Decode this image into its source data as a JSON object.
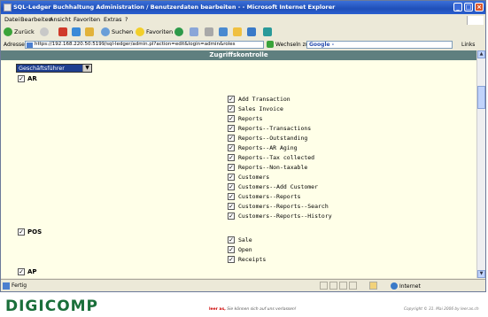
{
  "window": {
    "title": "SQL-Ledger Buchhaltung Administration / Benutzerdaten bearbeiten - - Microsoft Internet Explorer",
    "controls": [
      "_",
      "□",
      "×"
    ]
  },
  "menu": [
    "Datei",
    "Bearbeiten",
    "Ansicht",
    "Favoriten",
    "Extras",
    "?"
  ],
  "toolbar": {
    "back": "Zurück",
    "search": "Suchen",
    "favorites": "Favoriten"
  },
  "address": {
    "label": "Adresse",
    "url": "https://192.168.220.50:5199/sql-ledger/admin.pl?action=edit&login=admin&roles",
    "go": "Wechseln zu",
    "google": "Google -",
    "links": "Links"
  },
  "page": {
    "heading": "Zugriffskontrolle",
    "role_select": "Geschäftsführer",
    "groups": [
      {
        "name": "AR",
        "items": [
          "Add Transaction",
          "Sales Invoice",
          "Reports",
          "Reports--Transactions",
          "Reports--Outstanding",
          "Reports--AR Aging",
          "Reports--Tax collected",
          "Reports--Non-taxable",
          "Customers",
          "Customers--Add Customer",
          "Customers--Reports",
          "Customers--Reports--Search",
          "Customers--Reports--History"
        ]
      },
      {
        "name": "POS",
        "items": [
          "Sale",
          "Open",
          "Receipts"
        ]
      },
      {
        "name": "AP",
        "items": []
      }
    ]
  },
  "status": {
    "text": "Fertig",
    "zone": "Internet"
  },
  "footer": {
    "brand": "DIGICOMP",
    "mid_bold": "leer as,",
    "mid_text": " Sie können sich auf uns verlassen!",
    "right": "Copyright © 31. Mai 2006 by leer.as.ch"
  }
}
